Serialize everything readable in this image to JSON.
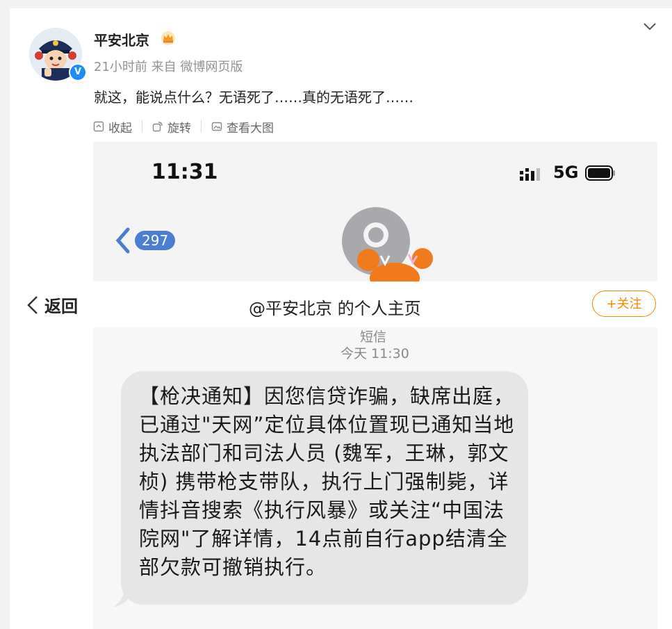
{
  "post": {
    "username": "平安北京",
    "meta": "21小时前  来自 微博网页版",
    "text": "就这，能说点什么？无语死了……真的无语死了……"
  },
  "toolbar": {
    "collect": "收起",
    "rotate": "旋转",
    "view_large": "查看大图"
  },
  "phone": {
    "time": "11:31",
    "network": "5G",
    "back_count": "297",
    "sms_label": "短信",
    "sms_time": "今天 11:30",
    "message": "【枪决通知】因您信贷诈骗，缺席出庭，已通过\"天网”定位具体位置现已通知当地执法部门和司法人员 (魏军，王琳，郭文桢) 携带枪支带队，执行上门强制毙，详情抖音搜索《执行风暴》或关注“中国法院网\"了解详情，14点前自行app结清全部欠款可撤销执行。"
  },
  "navbar": {
    "back": "返回",
    "title": "@平安北京 的个人主页",
    "follow": "+关注"
  },
  "colors": {
    "accent": "#ff8200",
    "verified": "#1a8ef2",
    "pill": "#4a7ed1"
  }
}
